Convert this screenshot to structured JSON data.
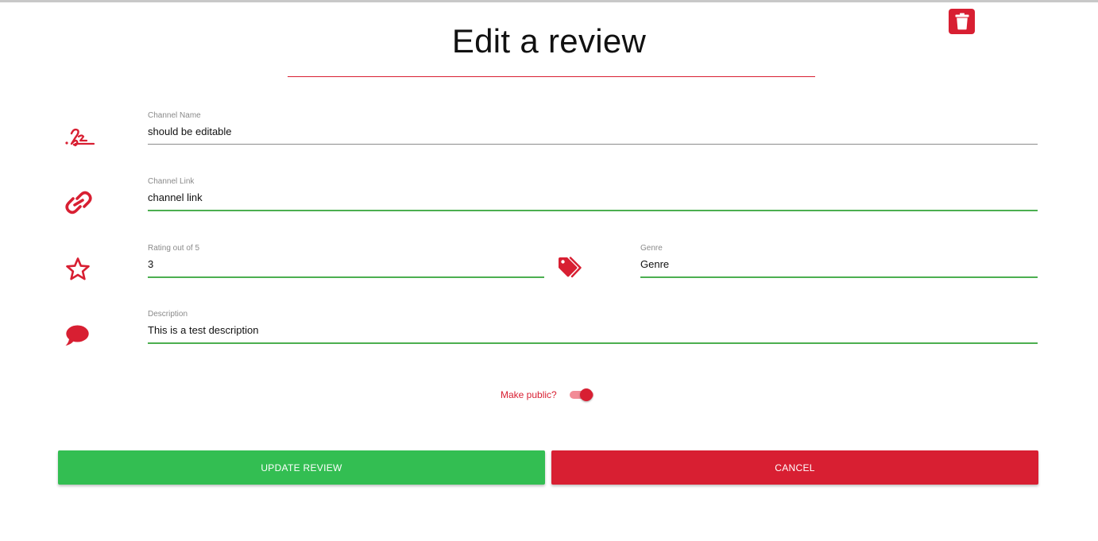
{
  "page": {
    "title": "Edit a review",
    "accent_color": "#d81f32",
    "success_color": "#33be52"
  },
  "toolbar": {
    "delete_icon": "trash-icon"
  },
  "form": {
    "channel_name": {
      "label": "Channel Name",
      "value": "should be editable",
      "icon": "signature-icon"
    },
    "channel_link": {
      "label": "Channel Link",
      "value": "channel link",
      "icon": "link-icon"
    },
    "rating": {
      "label": "Rating out of 5",
      "value": "3",
      "icon": "star-icon"
    },
    "genre": {
      "label": "Genre",
      "value": "Genre",
      "icon": "tags-icon"
    },
    "description": {
      "label": "Description",
      "value": "This is a test description",
      "icon": "comment-icon"
    },
    "make_public": {
      "label": "Make public?",
      "checked": true
    }
  },
  "actions": {
    "update_label": "UPDATE REVIEW",
    "cancel_label": "CANCEL"
  }
}
